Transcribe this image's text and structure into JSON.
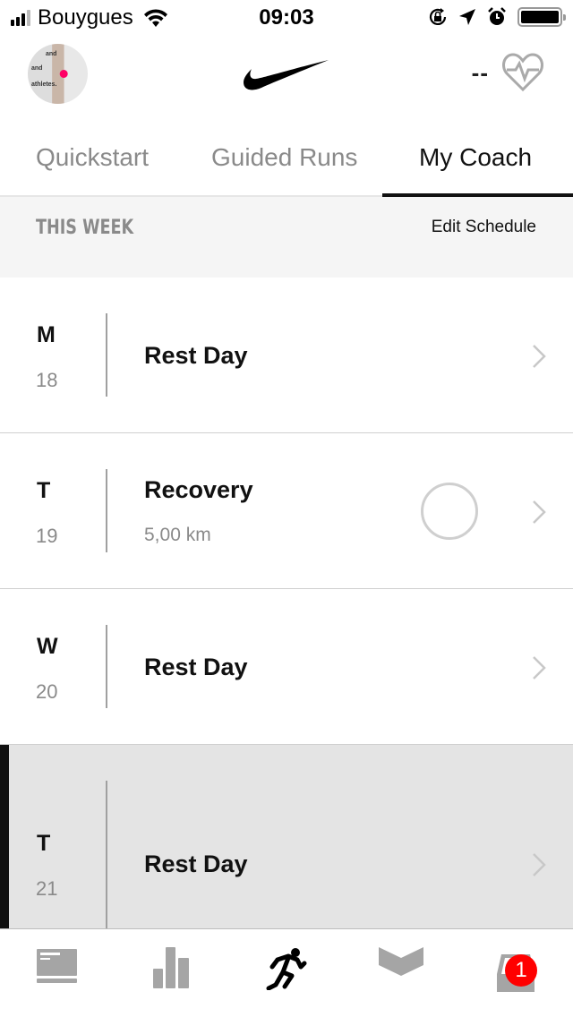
{
  "status_bar": {
    "carrier": "Bouygues",
    "time": "09:03",
    "signal_bars": 3,
    "signal_bars_total": 4,
    "icons": [
      "wifi-icon",
      "rotation-lock-icon",
      "location-arrow-icon",
      "alarm-icon",
      "battery-icon"
    ],
    "battery_level": 1.0
  },
  "header": {
    "avatar_label": "Profile photo",
    "logo": "nike-swoosh",
    "heart_rate_value": "--",
    "heart_rate_icon": "heart-rate-icon"
  },
  "tabs": [
    {
      "label": "Quickstart",
      "active": false
    },
    {
      "label": "Guided Runs",
      "active": false
    },
    {
      "label": "My Coach",
      "active": true
    }
  ],
  "week": {
    "title": "THIS WEEK",
    "edit_label": "Edit Schedule"
  },
  "days": [
    {
      "letter": "M",
      "date": "18",
      "title": "Rest Day",
      "subtitle": "",
      "has_progress": false,
      "today": false
    },
    {
      "letter": "T",
      "date": "19",
      "title": "Recovery",
      "subtitle": "5,00 km",
      "has_progress": true,
      "progress": 0,
      "today": false
    },
    {
      "letter": "W",
      "date": "20",
      "title": "Rest Day",
      "subtitle": "",
      "has_progress": false,
      "today": false
    },
    {
      "letter": "T",
      "date": "21",
      "title": "Rest Day",
      "subtitle": "",
      "has_progress": false,
      "today": true
    }
  ],
  "tabbar": {
    "items": [
      {
        "name": "feed",
        "icon": "feed-icon",
        "active": false
      },
      {
        "name": "activity",
        "icon": "activity-chart-icon",
        "active": false
      },
      {
        "name": "run",
        "icon": "runner-icon",
        "active": true
      },
      {
        "name": "club",
        "icon": "club-chevron-icon",
        "active": false
      },
      {
        "name": "inbox",
        "icon": "inbox-icon",
        "active": false,
        "badge": "1"
      }
    ]
  },
  "colors": {
    "active": "#111111",
    "inactive": "#8a8a8a",
    "icon_gray": "#a5a5a5",
    "badge": "#ff0000",
    "today_bg": "#e4e4e4",
    "week_header_bg": "#f5f5f5"
  }
}
